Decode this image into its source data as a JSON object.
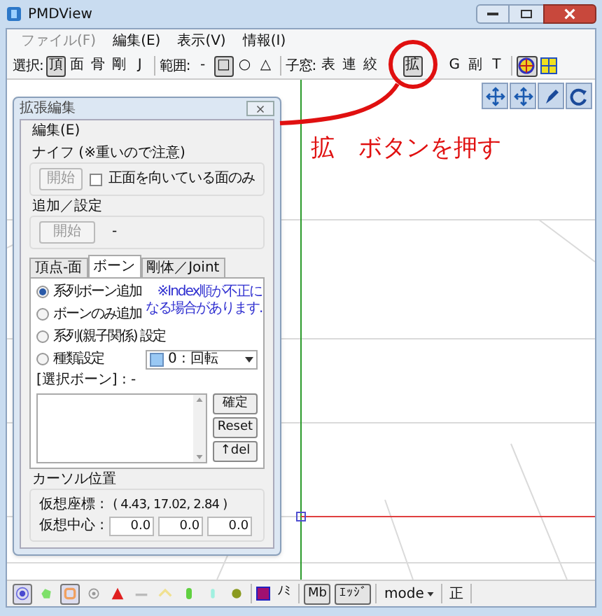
{
  "window": {
    "title": "PMDView"
  },
  "menu": [
    {
      "label": "ファイル(F)",
      "disabled": true
    },
    {
      "label": "編集(E)",
      "disabled": false
    },
    {
      "label": "表示(V)",
      "disabled": false
    },
    {
      "label": "情報(I)",
      "disabled": false
    }
  ],
  "toolbar": [
    {
      "label": "選択:",
      "buttons": [
        {
          "kind": "text",
          "label": "頂",
          "selected": true
        },
        {
          "kind": "text",
          "label": "面",
          "selected": false
        },
        {
          "kind": "text",
          "label": "骨",
          "selected": false
        },
        {
          "kind": "text",
          "label": "剛",
          "selected": false
        },
        {
          "kind": "text",
          "label": "J",
          "selected": false
        }
      ]
    },
    {
      "label": "範囲:",
      "buttons": [
        {
          "kind": "text",
          "label": "-",
          "selected": false
        },
        {
          "kind": "text",
          "label": "□",
          "selected": true
        },
        {
          "kind": "text",
          "label": "○",
          "selected": false
        },
        {
          "kind": "text",
          "label": "△",
          "selected": false
        }
      ]
    },
    {
      "label": "子窓:",
      "buttons": [
        {
          "kind": "text",
          "label": "表",
          "selected": false
        },
        {
          "kind": "text",
          "label": "連",
          "selected": false
        },
        {
          "kind": "text",
          "label": "絞",
          "selected": false
        },
        {
          "kind": "covered"
        },
        {
          "kind": "text",
          "label": "拡",
          "selected": true
        },
        {
          "kind": "covered"
        },
        {
          "kind": "text",
          "label": "G",
          "selected": false
        },
        {
          "kind": "text",
          "label": "副",
          "selected": false
        },
        {
          "kind": "text",
          "label": "T",
          "selected": false
        }
      ]
    }
  ],
  "toolbar_icons": [
    {
      "selected": true
    },
    {
      "selected": false
    }
  ],
  "annotation": "拡　ボタンを押す",
  "dialog": {
    "title": "拡張編集",
    "menu": "編集(E)",
    "knife": {
      "title": "ナイフ (※重いので注意)",
      "button": "開始",
      "button_disabled": true,
      "checkbox": {
        "label": "正面を向いている面のみ",
        "checked": false
      }
    },
    "add": {
      "title": "追加／設定",
      "button": "開始",
      "button_disabled": true,
      "status": "-"
    },
    "tabs": [
      {
        "label": "頂点-面",
        "selected": false
      },
      {
        "label": "ボーン",
        "selected": true
      },
      {
        "label": "剛体／Joint",
        "selected": false
      }
    ],
    "radios": [
      {
        "label": "系列ボーン追加",
        "selected": true
      },
      {
        "label": "ボーンのみ追加",
        "selected": false
      },
      {
        "label": "系列(親子関係) 設定",
        "selected": false
      },
      {
        "label": "種類設定",
        "selected": false
      }
    ],
    "note": [
      "※Index順が不正に",
      "なる場合があります."
    ],
    "type_select": "0 : 回転",
    "selected_label": "[選択ボーン] : -",
    "list_buttons": [
      "確定",
      "Reset",
      "↑del"
    ],
    "cursor": {
      "title": "カーソル位置",
      "coord_label": "仮想座標 :",
      "coord_value": "( 4.43, 17.02, 2.84 )",
      "center_label": "仮想中心 :",
      "center_values": [
        "0.0",
        "0.0",
        "0.0"
      ]
    }
  },
  "bottom_toolbar": {
    "icons": [
      {
        "selected": true
      },
      {
        "selected": false
      },
      {
        "selected": true
      },
      {
        "selected": false
      },
      {
        "selected": false
      },
      {
        "selected": false
      },
      {
        "selected": false
      },
      {
        "selected": false
      },
      {
        "selected": false
      },
      {
        "selected": false
      }
    ],
    "color_label": "ﾉﾐ",
    "buttons": [
      {
        "label": "Mb",
        "selected": true
      },
      {
        "label": "ｴｯｼﾞ",
        "selected": true
      }
    ],
    "mode": "mode",
    "last": "正"
  }
}
